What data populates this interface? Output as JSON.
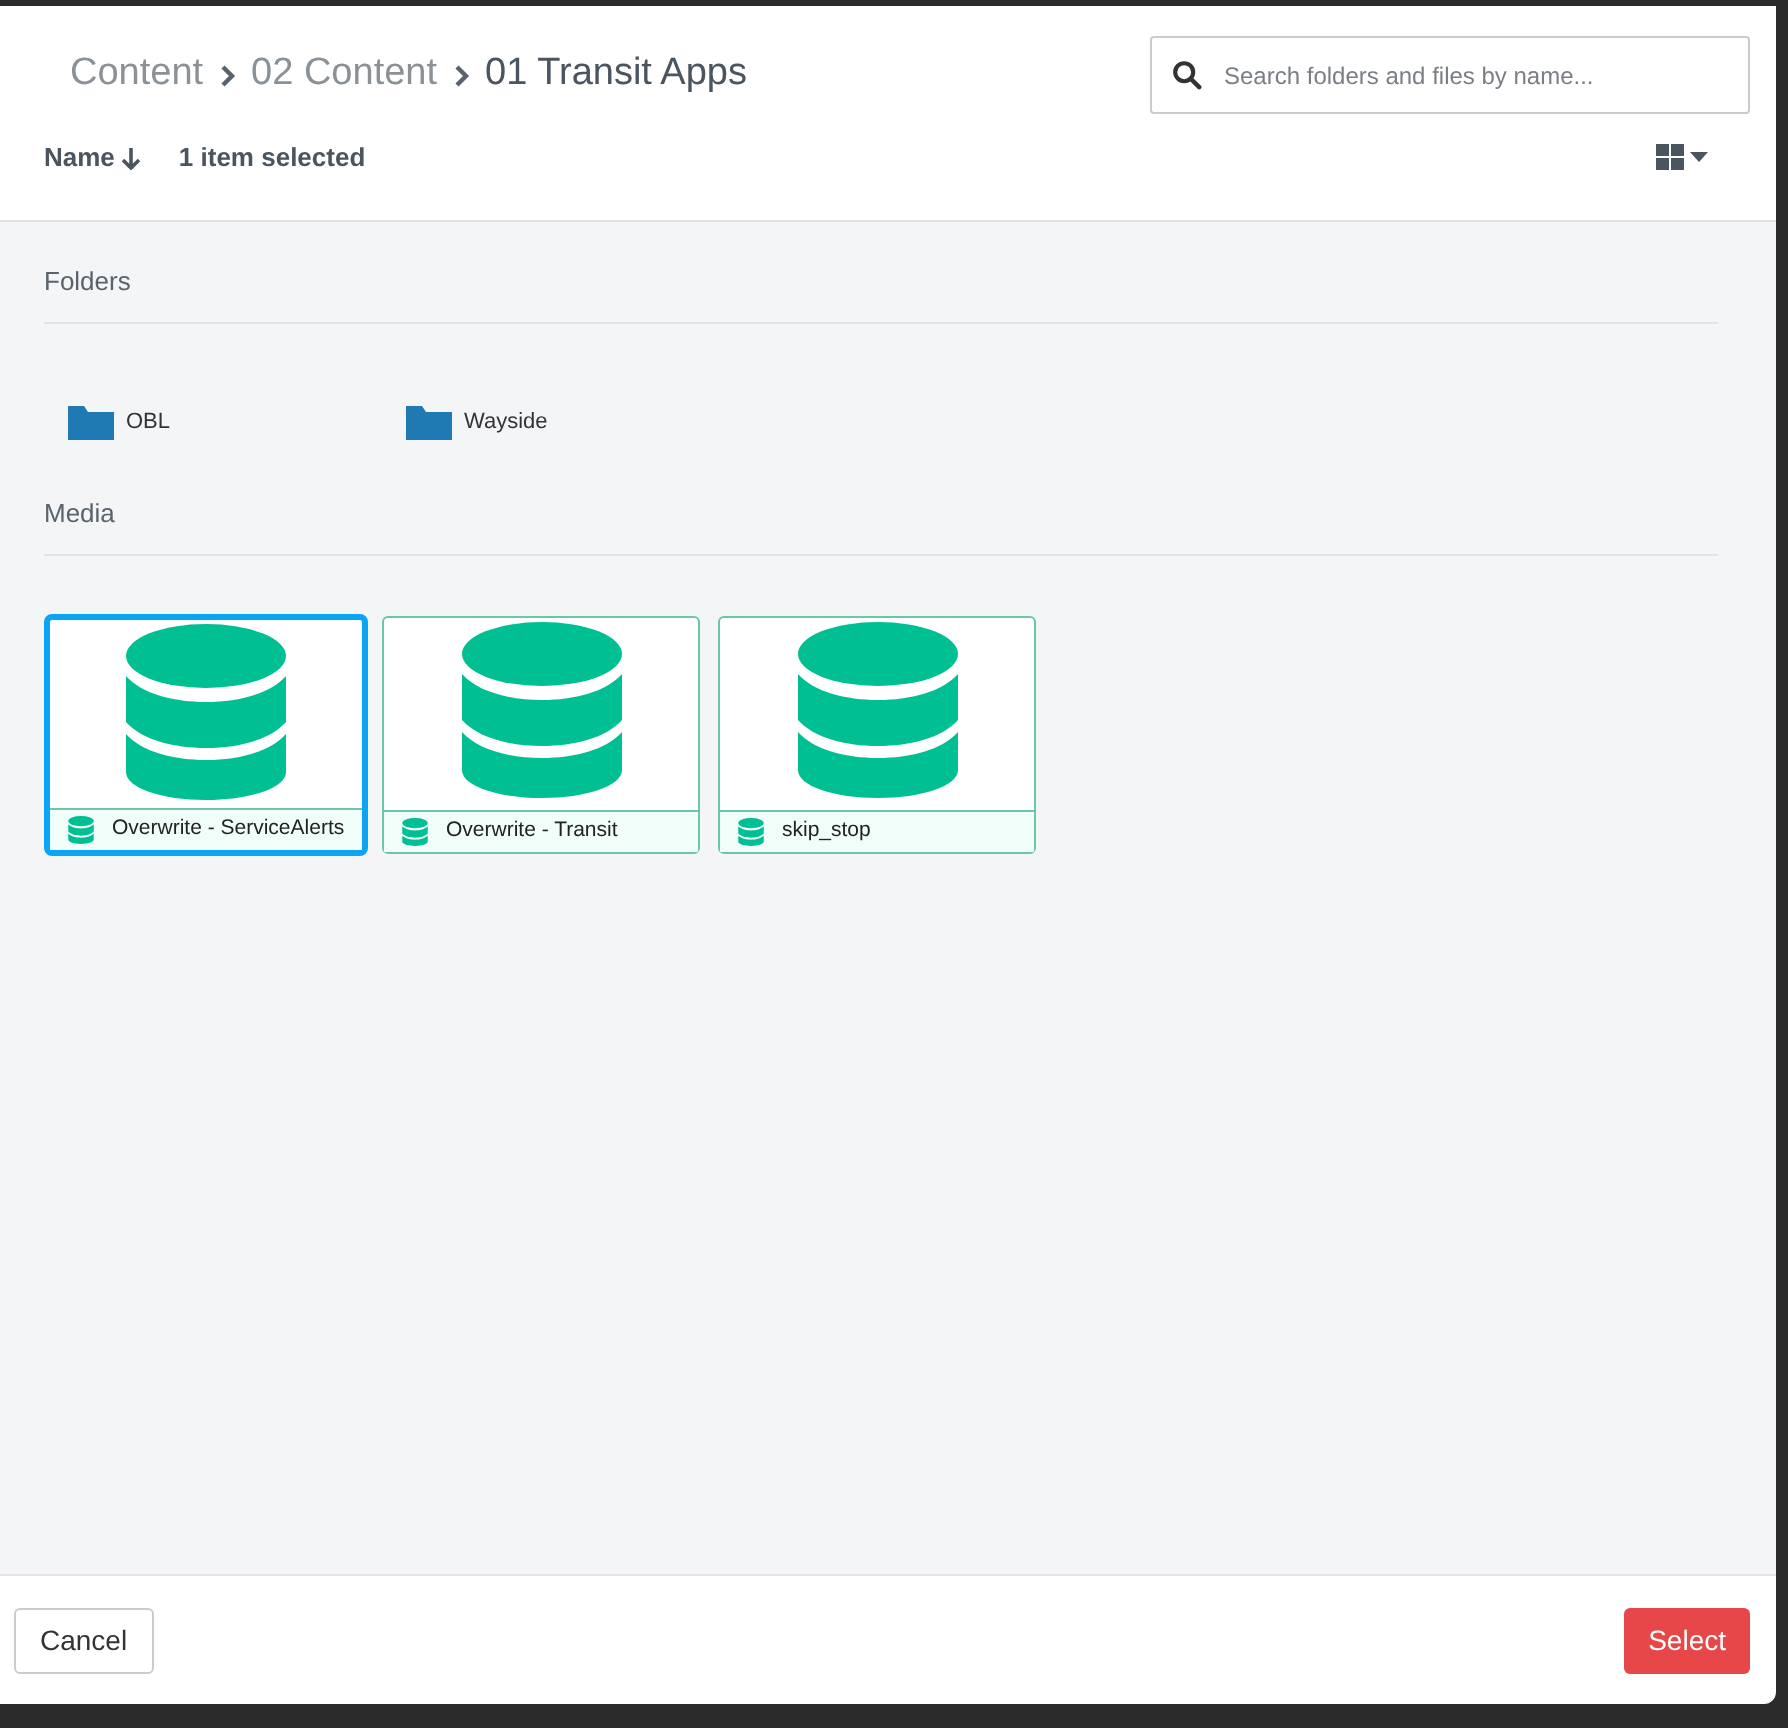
{
  "breadcrumb": [
    {
      "label": "Content",
      "current": false
    },
    {
      "label": "02 Content",
      "current": false
    },
    {
      "label": "01 Transit Apps",
      "current": true
    }
  ],
  "search": {
    "placeholder": "Search folders and files by name..."
  },
  "toolbar": {
    "sort_label": "Name",
    "selection_count": "1 item selected"
  },
  "folders": {
    "heading": "Folders",
    "items": [
      {
        "name": "OBL"
      },
      {
        "name": "Wayside"
      }
    ]
  },
  "media": {
    "heading": "Media",
    "items": [
      {
        "name": "Overwrite - ServiceAlerts",
        "selected": true
      },
      {
        "name": "Overwrite - Transit",
        "selected": false
      },
      {
        "name": "skip_stop",
        "selected": false
      }
    ]
  },
  "footer": {
    "cancel": "Cancel",
    "confirm": "Select"
  }
}
